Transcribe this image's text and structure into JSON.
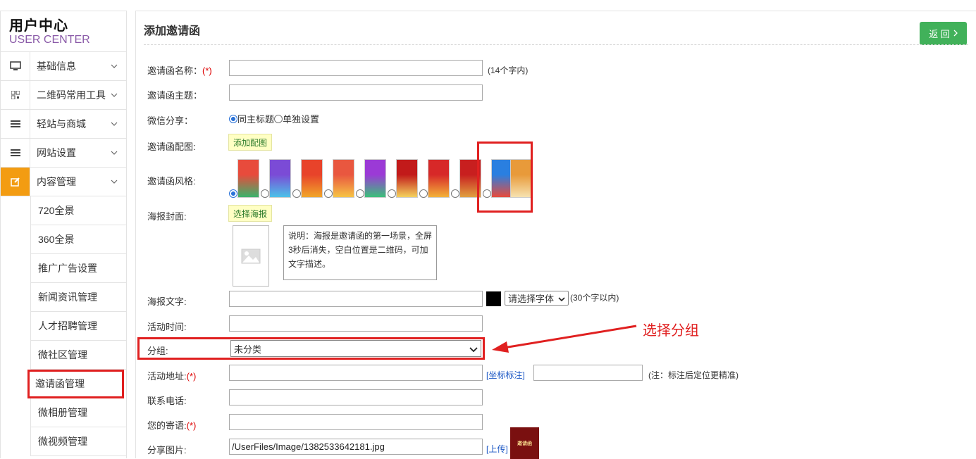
{
  "sidebar": {
    "logo_title": "用户中心",
    "logo_sub": "USER CENTER",
    "menu": [
      {
        "label": "基础信息",
        "icon": "monitor-icon"
      },
      {
        "label": "二维码常用工具",
        "icon": "qrcode-icon"
      },
      {
        "label": "轻站与商城",
        "icon": "list-icon"
      },
      {
        "label": "网站设置",
        "icon": "list-icon"
      },
      {
        "label": "内容管理",
        "icon": "edit-icon"
      }
    ],
    "sub": [
      "720全景",
      "360全景",
      "推广广告设置",
      "新闻资讯管理",
      "人才招聘管理",
      "微社区管理",
      "邀请函管理",
      "微相册管理",
      "微视频管理"
    ]
  },
  "page": {
    "title": "添加邀请函",
    "back": "返 回",
    "colors": {
      "accent_green": "#41b15a",
      "menu_active": "#f39c12",
      "highlight_red": "#e02020"
    }
  },
  "form": {
    "name_label": "邀请函名称：",
    "name_req": "(*)",
    "name_hint": "(14个字内)",
    "theme_label": "邀请函主题：",
    "wechat_label": "微信分享：",
    "wechat_opt1": "同主标题",
    "wechat_opt2": "单独设置",
    "music_label": "邀请函配图:",
    "music_btn": "添加配图",
    "style_label": "邀请函风格:",
    "poster_label": "海报封面:",
    "poster_btn": "选择海报",
    "poster_desc": "说明：海报是邀请函的第一场景，全屏3秒后消失，空白位置是二维码，可加文字描述。",
    "poster_text_label": "海报文字:",
    "font_select": "请选择字体",
    "poster_text_hint": "(30个字以内)",
    "time_label": "活动时间:",
    "group_label": "分组:",
    "group_value": "未分类",
    "addr_label": "活动地址:",
    "addr_req": "(*)",
    "coord_link": "[坐标标注]",
    "addr_hint": "(注：标注后定位更精准)",
    "phone_label": "联系电话:",
    "message_label": "您的寄语:",
    "message_req": "(*)",
    "share_label": "分享图片:",
    "share_value": "/UserFiles/Image/1382533642181.jpg",
    "upload_link": "[上传]",
    "share_thumb_text": "邀请函"
  },
  "annotation": {
    "text": "选择分组"
  }
}
